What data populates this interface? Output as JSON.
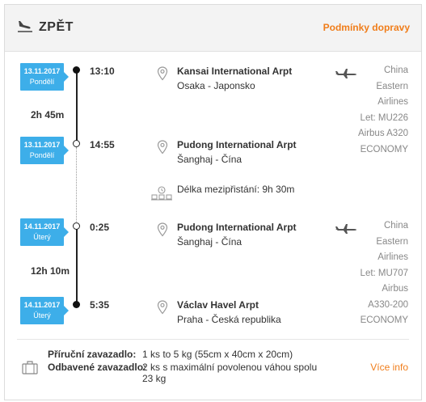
{
  "header": {
    "title": "ZPĚT",
    "terms_link": "Podmínky dopravy"
  },
  "segments": [
    {
      "departure": {
        "date": "13.11.2017",
        "weekday": "Pondělí",
        "time": "13:10",
        "airport": "Kansai International Arpt",
        "place": "Osaka - Japonsko"
      },
      "duration": "2h 45m",
      "arrival": {
        "date": "13.11.2017",
        "weekday": "Pondělí",
        "time": "14:55",
        "airport": "Pudong International Arpt",
        "place": "Šanghaj - Čína"
      },
      "info_lines": [
        "China",
        "Eastern",
        "Airlines",
        "Let: MU226",
        "Airbus A320",
        "ECONOMY"
      ]
    },
    {
      "departure": {
        "date": "14.11.2017",
        "weekday": "Úterý",
        "time": "0:25",
        "airport": "Pudong International Arpt",
        "place": "Šanghaj - Čína"
      },
      "duration": "12h 10m",
      "arrival": {
        "date": "14.11.2017",
        "weekday": "Úterý",
        "time": "5:35",
        "airport": "Václav Havel Arpt",
        "place": "Praha - Česká republika"
      },
      "info_lines": [
        "China",
        "Eastern",
        "Airlines",
        "Let: MU707",
        "Airbus",
        "A330-200",
        "ECONOMY"
      ]
    }
  ],
  "layover": "Délka mezipřistání: 9h 30m",
  "baggage": {
    "cabin_label": "Příruční zavazadlo:",
    "cabin_value": "1 ks to 5 kg (55cm x 40cm x 20cm)",
    "checked_label": "Odbavené zavazadlo:",
    "checked_value_line1": "2 ks s maximální povolenou váhou spolu",
    "checked_value_line2": "23 kg",
    "more_link": "Více info"
  },
  "icons": {
    "header": "plane-landing-icon",
    "location": "map-pin-icon",
    "airplane": "airplane-icon",
    "layover": "waiting-room-icon",
    "baggage": "luggage-icon"
  },
  "colors": {
    "accent": "#f07d1a",
    "badge": "#3daee9",
    "header_bg": "#f3f3f3"
  }
}
